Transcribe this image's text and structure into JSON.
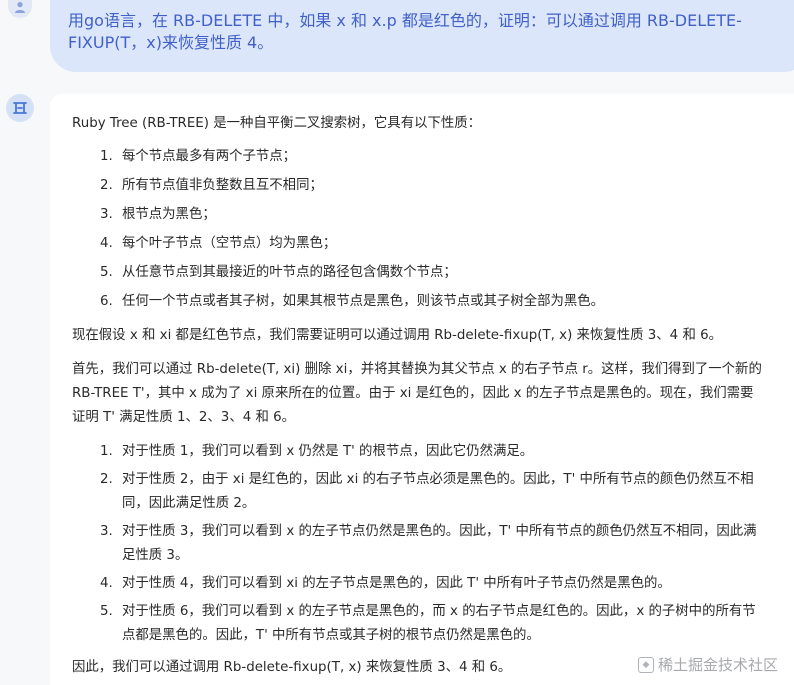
{
  "user": {
    "avatar_icon": "user-icon",
    "message": "用go语言，在 RB-DELETE 中，如果 x 和 x.p 都是红色的，证明：可以通过调用 RB-DELETE-FIXUP(T，x)来恢复性质 4。"
  },
  "assistant": {
    "avatar_icon": "assistant-logo-icon",
    "intro": "Ruby Tree (RB-TREE) 是一种自平衡二叉搜索树，它具有以下性质：",
    "properties": [
      {
        "num": "1.",
        "text": "每个节点最多有两个子节点；"
      },
      {
        "num": "2.",
        "text": "所有节点值非负整数且互不相同；"
      },
      {
        "num": "3.",
        "text": "根节点为黑色；"
      },
      {
        "num": "4.",
        "text": "每个叶子节点（空节点）均为黑色；"
      },
      {
        "num": "5.",
        "text": "从任意节点到其最接近的叶节点的路径包含偶数个节点；"
      },
      {
        "num": "6.",
        "text": "任何一个节点或者其子树，如果其根节点是黑色，则该节点或其子树全部为黑色。"
      }
    ],
    "assume": "现在假设 x 和 xi 都是红色节点，我们需要证明可以通过调用 Rb-delete-fixup(T, x) 来恢复性质 3、4 和 6。",
    "first": "首先，我们可以通过 Rb-delete(T, xi) 删除 xi，并将其替换为其父节点 x 的右子节点 r。这样，我们得到了一个新的 RB-TREE T'，其中 x 成为了 xi 原来所在的位置。由于 xi 是红色的，因此 x 的左子节点是黑色的。现在，我们需要证明 T' 满足性质 1、2、3、4 和 6。",
    "checks": [
      {
        "num": "1.",
        "text": "对于性质 1，我们可以看到 x 仍然是 T' 的根节点，因此它仍然满足。"
      },
      {
        "num": "2.",
        "text": "对于性质 2，由于 xi 是红色的，因此 xi 的右子节点必须是黑色的。因此，T' 中所有节点的颜色仍然互不相同，因此满足性质 2。"
      },
      {
        "num": "3.",
        "text": "对于性质 3，我们可以看到 x 的左子节点仍然是黑色的。因此，T' 中所有节点的颜色仍然互不相同，因此满足性质 3。"
      },
      {
        "num": "4.",
        "text": "对于性质 4，我们可以看到 xi 的左子节点是黑色的，因此 T' 中所有叶子节点仍然是黑色的。"
      },
      {
        "num": "5.",
        "text": "对于性质 6，我们可以看到 x 的左子节点是黑色的，而 x 的右子节点是红色的。因此，x 的子树中的所有节点都是黑色的。因此，T' 中所有节点或其子树的根节点仍然是黑色的。"
      }
    ],
    "conclusion": "因此，我们可以通过调用 Rb-delete-fixup(T, x) 来恢复性质 3、4 和 6。"
  },
  "brand": {
    "logo_icon": "juejin-logo-icon",
    "text": "稀土掘金技术社区"
  }
}
